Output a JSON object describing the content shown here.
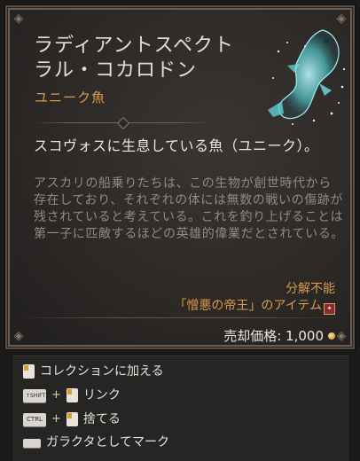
{
  "item": {
    "name": "ラディアントスペクト\nラル・コカロドン",
    "type": "ユニーク魚",
    "lead": "スコヴォスに生息している魚（ユニーク）。",
    "flavor": "アスカリの船乗りたちは、この生物が創世時代から存在しており、それぞれの体には無数の戦いの傷跡が残されていると考えている。これを釣り上げることは第一子に匹敵するほどの英雄的偉業だとされている。",
    "no_salvage": "分解不能",
    "set_text": "「憎悪の帝王」のアイテム",
    "price_label": "売却価格:",
    "price_value": "1,000"
  },
  "keys": {
    "shift": "↑SHIFT",
    "ctrl": "CTRL"
  },
  "hints": [
    {
      "label": "コレクションに加える",
      "icon": "left-mouse-icon"
    },
    {
      "label": "リンク",
      "icon": "shift-plus-left-mouse"
    },
    {
      "label": "捨てる",
      "icon": "ctrl-plus-left-mouse"
    },
    {
      "label": "ガラクタとしてマーク",
      "icon": "space-key-icon"
    }
  ],
  "colors": {
    "title": "#e6dfcf",
    "unique": "#d99a4a",
    "flavor": "#8f8a84",
    "panel": "#2b2826"
  }
}
